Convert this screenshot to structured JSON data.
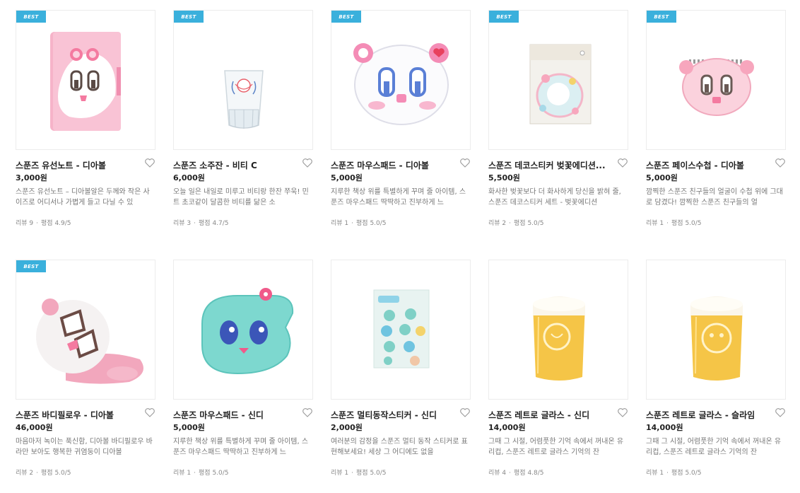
{
  "products": [
    {
      "badge": "BEST",
      "title": "스푼즈 유선노트 - 디아볼",
      "price": "3,000원",
      "desc": "스푼즈 유선노트 – 디아볼알은 두께와 작은 사이즈로 어디서나 가볍게 들고 다닐 수 있",
      "reviews": "리뷰 9",
      "rating": "평점 4.9/5",
      "image": "pink-notebook"
    },
    {
      "badge": "BEST",
      "title": "스푼즈 소주잔 - 비티 C",
      "price": "6,000원",
      "desc": "오늘 일은 내일로 미루고 비티랑 한잔 쭈욱! 민트 초코같이 달콤한 비티를 닮은 소",
      "reviews": "리뷰 3",
      "rating": "평점 4.7/5",
      "image": "soju-glass"
    },
    {
      "badge": "BEST",
      "title": "스푼즈 마우스패드 - 디아볼",
      "price": "5,000원",
      "desc": "지루한 책상 위를 특별하게 꾸며 줄 아이템, 스푼즈 마우스패드 딱딱하고 진부하게 느",
      "reviews": "리뷰 1",
      "rating": "평점 5.0/5",
      "image": "white-mousepad"
    },
    {
      "badge": "BEST",
      "title": "스푼즈 데코스티커 벚꽃에디션...",
      "price": "5,500원",
      "desc": "화사한 벚꽃보다 더 화사하게 당신을 밝혀 줄, 스푼즈 데코스티커 세트 - 벚꽃에디션",
      "reviews": "리뷰 2",
      "rating": "평점 5.0/5",
      "image": "sticker-pack"
    },
    {
      "badge": "BEST",
      "title": "스푼즈 페이스수첩 - 디아볼",
      "price": "5,000원",
      "desc": "깜찍한 스푼즈 친구들의 얼굴이 수첩 위에 그대로 담겼다! 깜찍한 스푼즈 친구들의 얼",
      "reviews": "리뷰 1",
      "rating": "평점 5.0/5",
      "image": "face-notebook"
    },
    {
      "badge": "BEST",
      "title": "스푼즈 바디필로우 - 디아볼",
      "price": "46,000원",
      "desc": "마음마저 녹이는 푹신함, 디아볼 바디필로우 바라만 보아도 행복한 귀염둥이 디아볼",
      "reviews": "리뷰 2",
      "rating": "평점 5.0/5",
      "image": "body-pillow"
    },
    {
      "badge": "",
      "title": "스푼즈 마우스패드 - 신디",
      "price": "5,000원",
      "desc": "지루한 책상 위를 특별하게 꾸며 줄 아이템, 스푼즈 마우스패드 딱딱하고 진부하게 느",
      "reviews": "리뷰 1",
      "rating": "평점 5.0/5",
      "image": "teal-mousepad"
    },
    {
      "badge": "",
      "title": "스푼즈 멀티동작스티커 - 신디",
      "price": "2,000원",
      "desc": "여러분의 감정을 스푼즈 멀티 동작 스티커로 표현해보세요! 세상 그 어디에도 없을",
      "reviews": "리뷰 1",
      "rating": "평점 5.0/5",
      "image": "multi-sticker"
    },
    {
      "badge": "",
      "title": "스푼즈 레트로 글라스 - 신디",
      "price": "14,000원",
      "desc": "그때 그 시절, 어렴풋한 기억 속에서 꺼내온 유리컵, 스푼즈 레트로 글라스 기억의 잔",
      "reviews": "리뷰 4",
      "rating": "평점 4.8/5",
      "image": "beer-glass"
    },
    {
      "badge": "",
      "title": "스푼즈 레트로 글라스 - 슬라임",
      "price": "14,000원",
      "desc": "그때 그 시절, 어렴풋한 기억 속에서 꺼내온 유리컵, 스푼즈 레트로 글라스 기억의 잔",
      "reviews": "리뷰 1",
      "rating": "평점 5.0/5",
      "image": "beer-glass-2"
    }
  ],
  "colors": {
    "badge": "#3ab0dc",
    "title": "#222222",
    "desc": "#777777",
    "border": "#ececec"
  }
}
